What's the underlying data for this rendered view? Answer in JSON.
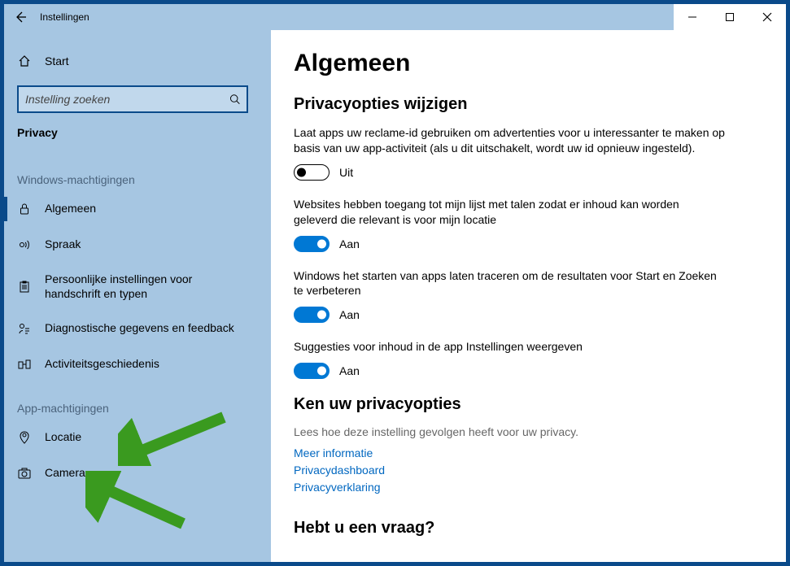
{
  "titlebar": {
    "title": "Instellingen"
  },
  "sidebar": {
    "home": "Start",
    "search_placeholder": "Instelling zoeken",
    "category": "Privacy",
    "group1_label": "Windows-machtigingen",
    "group1": {
      "algemeen": "Algemeen",
      "spraak": "Spraak",
      "handschrift": "Persoonlijke instellingen voor handschrift en typen",
      "diagnostiek": "Diagnostische gegevens en feedback",
      "activiteit": "Activiteitsgeschiedenis"
    },
    "group2_label": "App-machtigingen",
    "group2": {
      "locatie": "Locatie",
      "camera": "Camera"
    }
  },
  "main": {
    "title": "Algemeen",
    "section1_title": "Privacyopties wijzigen",
    "opt1_desc": "Laat apps uw reclame-id gebruiken om advertenties voor u interessanter te maken op basis van uw app-activiteit (als u dit uitschakelt, wordt uw id opnieuw ingesteld).",
    "opt1_state": "Uit",
    "opt2_desc": "Websites hebben toegang tot mijn lijst met talen zodat er inhoud kan worden geleverd die relevant is voor mijn locatie",
    "opt2_state": "Aan",
    "opt3_desc": "Windows het starten van apps laten traceren om de resultaten voor Start en Zoeken te verbeteren",
    "opt3_state": "Aan",
    "opt4_desc": "Suggesties voor inhoud in de app Instellingen weergeven",
    "opt4_state": "Aan",
    "section2_title": "Ken uw privacyopties",
    "section2_sub": "Lees hoe deze instelling gevolgen heeft voor uw privacy.",
    "link1": "Meer informatie",
    "link2": "Privacydashboard",
    "link3": "Privacyverklaring",
    "section3_title": "Hebt u een vraag?"
  }
}
